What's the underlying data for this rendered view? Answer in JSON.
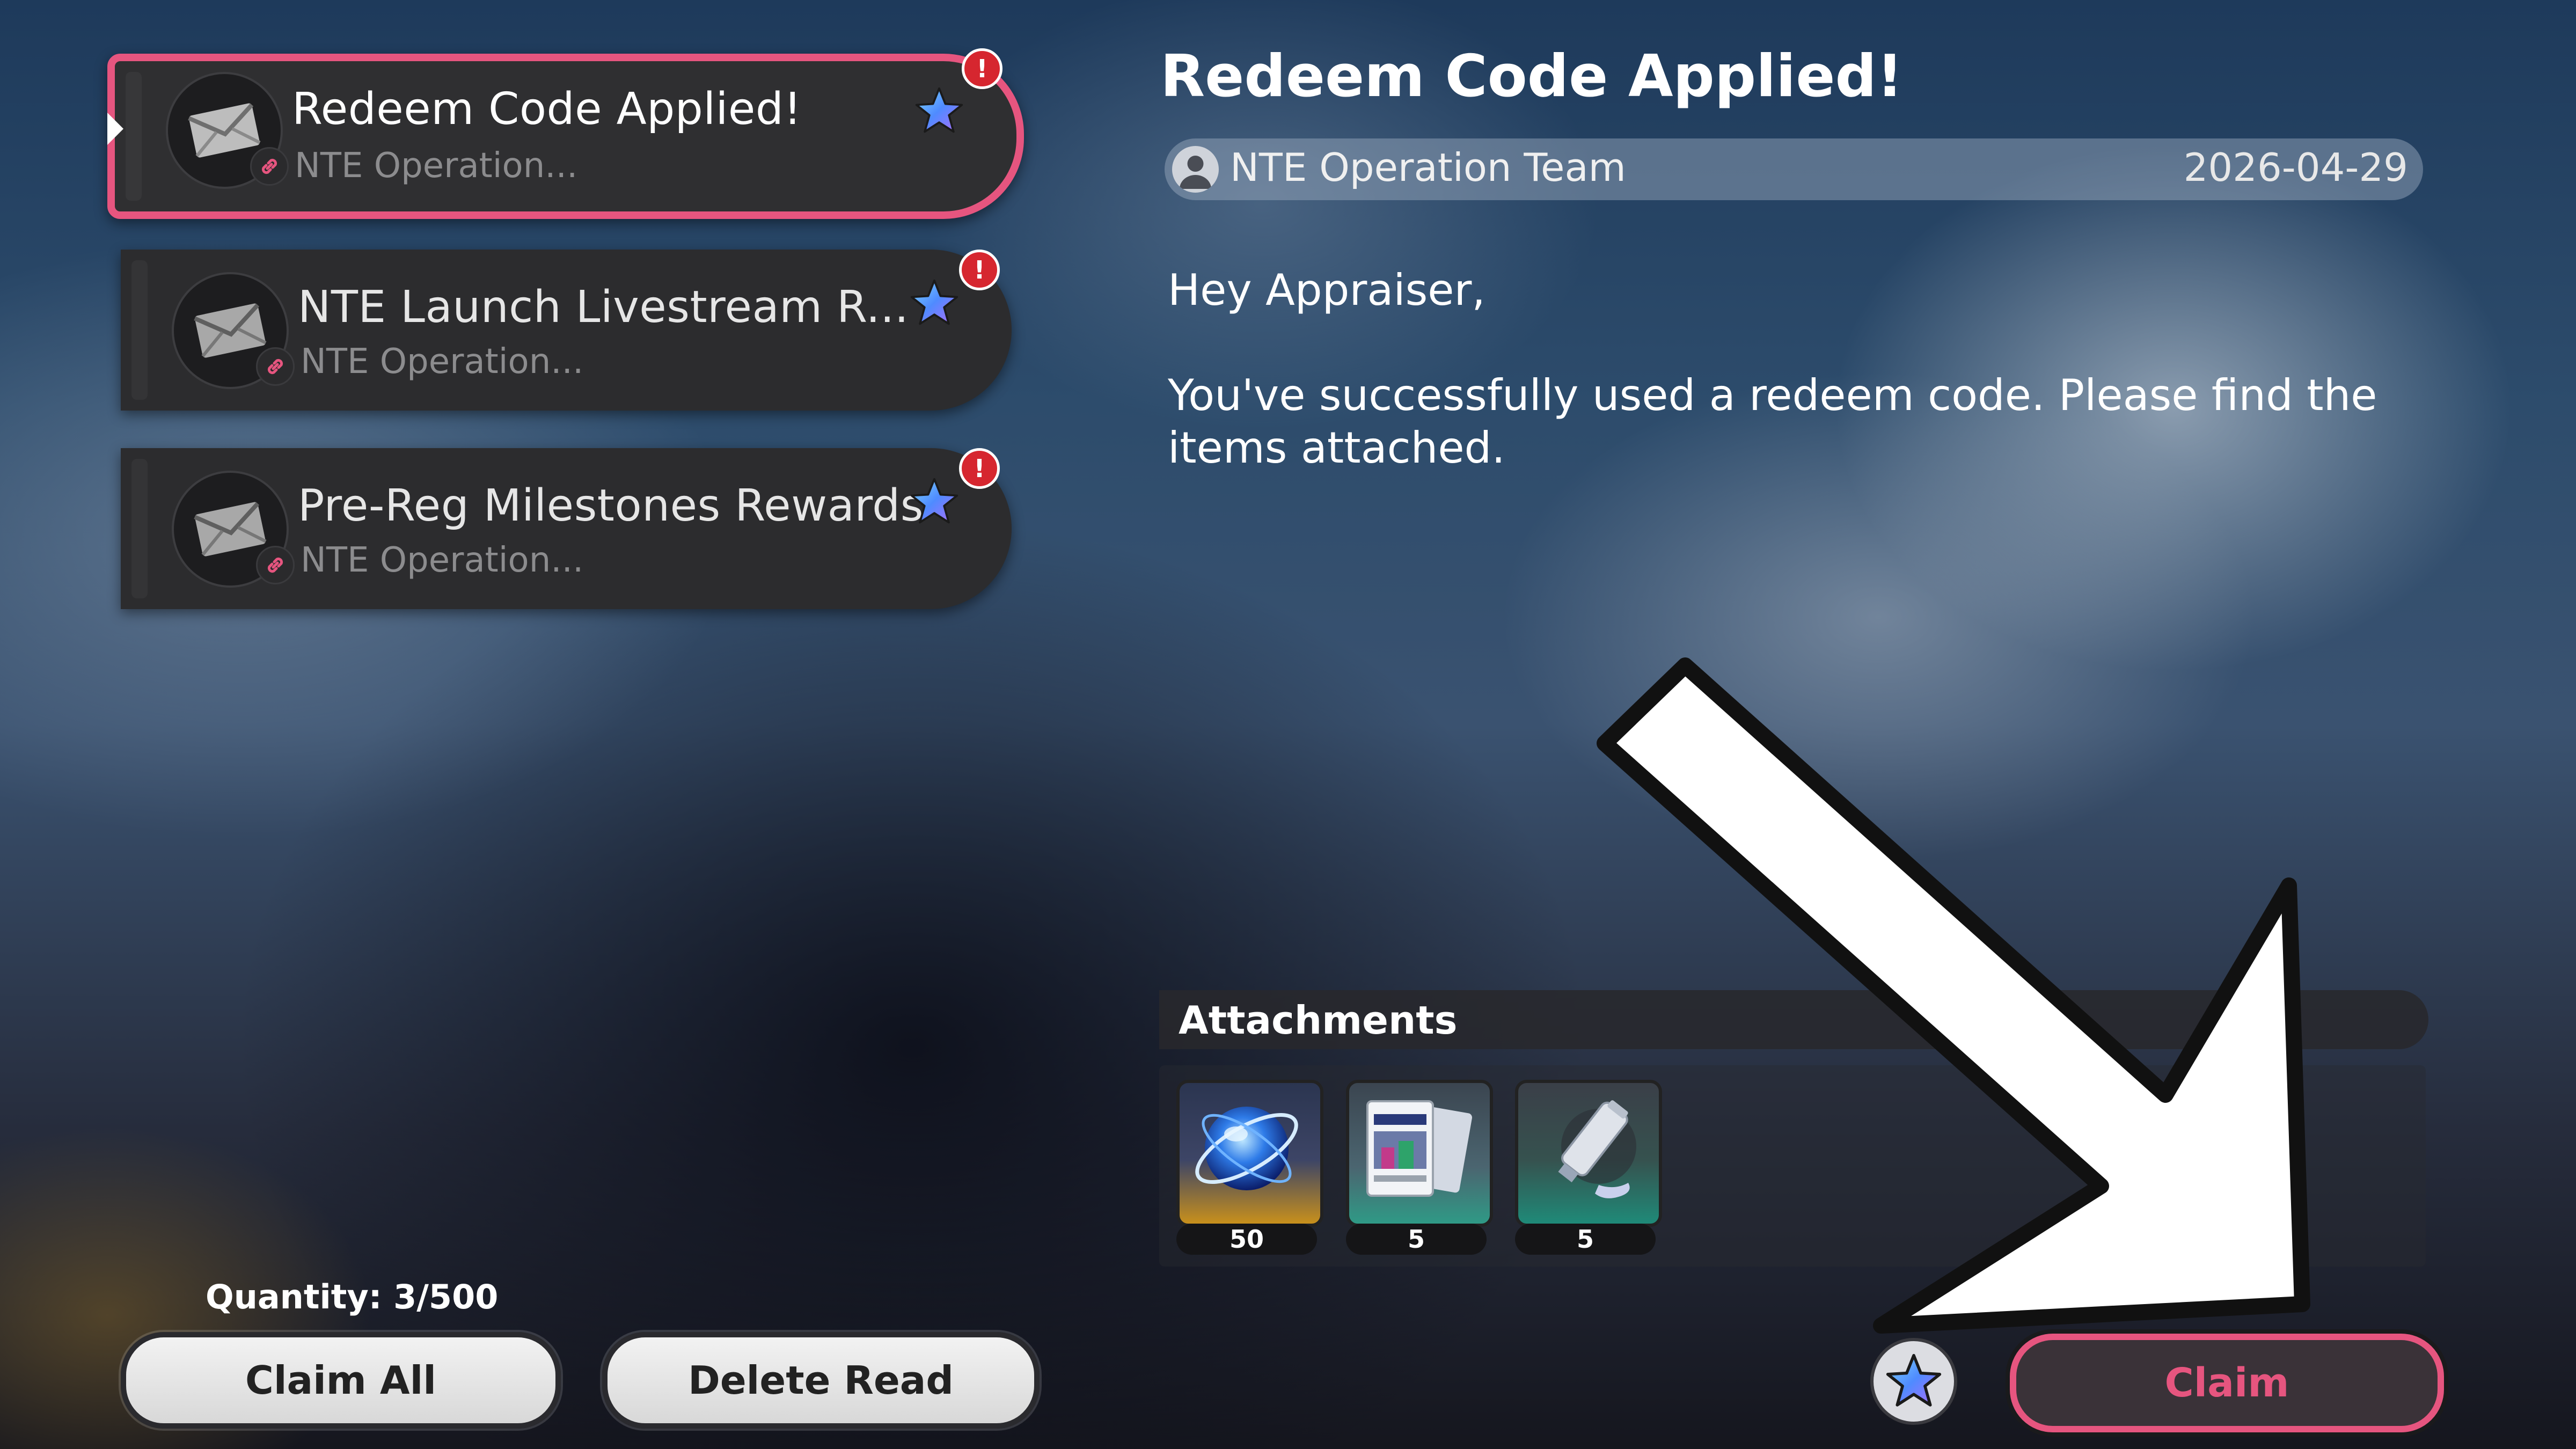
{
  "mail_list": {
    "items": [
      {
        "title": "Redeem Code Applied!",
        "sender_preview": "NTE Operation...",
        "selected": true,
        "unread": true
      },
      {
        "title": "NTE Launch Livestream R...",
        "sender_preview": "NTE Operation...",
        "selected": false,
        "unread": true
      },
      {
        "title": "Pre-Reg Milestones Rewards",
        "sender_preview": "NTE Operation...",
        "selected": false,
        "unread": true
      }
    ],
    "alert_glyph": "!"
  },
  "footer_left": {
    "quantity_text": "Quantity: 3/500",
    "claim_all_label": "Claim All",
    "delete_read_label": "Delete Read"
  },
  "detail": {
    "title": "Redeem Code Applied!",
    "sender": "NTE Operation Team",
    "date": "2026-04-29",
    "greeting": "Hey Appraiser,",
    "message": "You've successfully used a redeem code. Please find the items attached.",
    "attachments_label": "Attachments",
    "attachments": [
      {
        "icon": "blue-orb-icon",
        "count": "50"
      },
      {
        "icon": "cards-icon",
        "count": "5"
      },
      {
        "icon": "paint-tube-icon",
        "count": "5"
      }
    ],
    "claim_label": "Claim"
  },
  "colors": {
    "accent_pink": "#e6557f",
    "alert_red": "#d6262f",
    "star_blue": "#3d8bf2"
  }
}
